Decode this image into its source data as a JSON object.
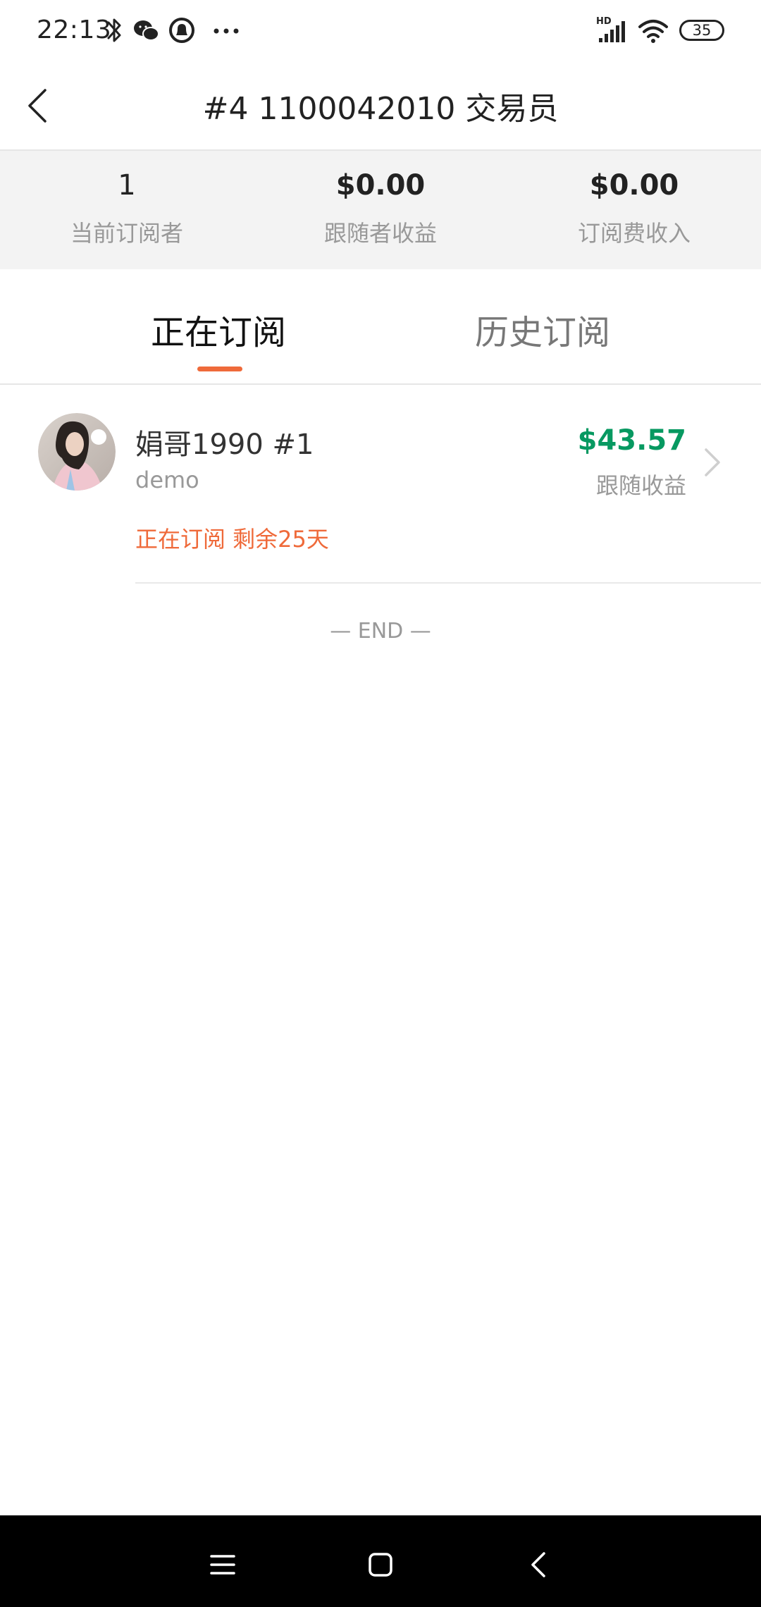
{
  "status_bar": {
    "time": "22:13",
    "battery": "35",
    "icons": [
      "bluetooth-icon",
      "wechat-icon",
      "notification-icon",
      "more-dots-icon",
      "hd-signal-icon",
      "wifi-icon",
      "battery-icon"
    ]
  },
  "navbar": {
    "title": "#4 1100042010 交易员"
  },
  "stats": [
    {
      "value": "1",
      "label": "当前订阅者"
    },
    {
      "value": "$0.00",
      "label": "跟随者收益"
    },
    {
      "value": "$0.00",
      "label": "订阅费收入"
    }
  ],
  "tabs": [
    {
      "label": "正在订阅",
      "active": true
    },
    {
      "label": "历史订阅",
      "active": false
    }
  ],
  "subscriptions": [
    {
      "name": "娟哥1990 #1",
      "subtitle": "demo",
      "amount": "$43.57",
      "amount_label": "跟随收益",
      "status": "正在订阅 剩余25天"
    }
  ],
  "list_end": "— END —",
  "colors": {
    "accent": "#ef6a3a",
    "profit": "#079961",
    "muted": "#999999",
    "stats_bg": "#f3f3f3"
  }
}
